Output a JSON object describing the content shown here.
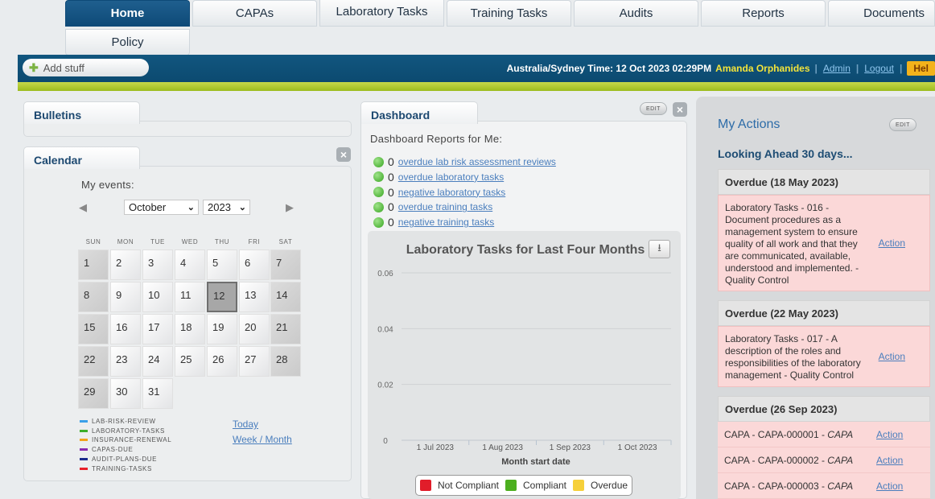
{
  "nav": {
    "tabs": [
      "Home",
      "CAPAs",
      "Laboratory Tasks",
      "Training Tasks",
      "Audits",
      "Reports",
      "Documents"
    ],
    "policy": "Policy"
  },
  "topbar": {
    "add_stuff": "Add stuff",
    "time_info": "Australia/Sydney Time: 12 Oct 2023 02:29PM",
    "user": "Amanda Orphanides",
    "admin": "Admin",
    "logout": "Logout",
    "help": "Hel"
  },
  "bulletins": {
    "title": "Bulletins"
  },
  "calendar": {
    "title": "Calendar",
    "my_events": "My events:",
    "month": "October",
    "year": "2023",
    "day_headers": [
      "SUN",
      "MON",
      "TUE",
      "WED",
      "THU",
      "FRI",
      "SAT"
    ],
    "weeks": [
      [
        "1",
        "2",
        "3",
        "4",
        "5",
        "6",
        "7"
      ],
      [
        "8",
        "9",
        "10",
        "11",
        "12",
        "13",
        "14"
      ],
      [
        "15",
        "16",
        "17",
        "18",
        "19",
        "20",
        "21"
      ],
      [
        "22",
        "23",
        "24",
        "25",
        "26",
        "27",
        "28"
      ],
      [
        "29",
        "30",
        "31"
      ]
    ],
    "today_day": "12",
    "legend": [
      {
        "label": "LAB-RISK-REVIEW",
        "color": "#3aa0e8"
      },
      {
        "label": "LABORATORY-TASKS",
        "color": "#3cae2c"
      },
      {
        "label": "INSURANCE-RENEWAL",
        "color": "#f0a21c"
      },
      {
        "label": "CAPAS-DUE",
        "color": "#8a2bb0"
      },
      {
        "label": "AUDIT-PLANS-DUE",
        "color": "#1c2b8c"
      },
      {
        "label": "TRAINING-TASKS",
        "color": "#e8202a"
      }
    ],
    "today_link": "Today",
    "week_month_link": "Week / Month"
  },
  "dashboard": {
    "title": "Dashboard",
    "edit": "EDIT",
    "reports_title": "Dashboard Reports for Me:",
    "reports": [
      {
        "count": "0",
        "label": "overdue lab risk assessment reviews"
      },
      {
        "count": "0",
        "label": "overdue laboratory tasks"
      },
      {
        "count": "0",
        "label": "negative laboratory tasks"
      },
      {
        "count": "0",
        "label": "overdue training tasks"
      },
      {
        "count": "0",
        "label": "negative training tasks"
      }
    ]
  },
  "chart_data": {
    "type": "bar",
    "title": "Laboratory Tasks for Last Four Months",
    "xlabel": "Month start date",
    "ylabel": "",
    "categories": [
      "1 Jul 2023",
      "1 Aug 2023",
      "1 Sep 2023",
      "1 Oct 2023"
    ],
    "yticks": [
      "0",
      "0.02",
      "0.04",
      "0.06"
    ],
    "ylim": [
      0,
      0.06
    ],
    "series": [
      {
        "name": "Not Compliant",
        "values": [
          0,
          0,
          0,
          0
        ],
        "color": "#e11d2a"
      },
      {
        "name": "Compliant",
        "values": [
          0,
          0,
          0,
          0
        ],
        "color": "#4caf1f"
      },
      {
        "name": "Overdue",
        "values": [
          0,
          0,
          0,
          0
        ],
        "color": "#f6d03a"
      }
    ],
    "grid": true,
    "legend_position": "bottom"
  },
  "my_actions": {
    "title": "My Actions",
    "edit": "EDIT",
    "looking_ahead": "Looking Ahead 30 days...",
    "groups": [
      {
        "header": "Overdue (18 May 2023)",
        "lines": [
          "Laboratory Tasks - 016 -",
          "Document procedures as a",
          "management system to ensure",
          "quality of all work and that they",
          "are communicated, available,",
          "understood and implemented. -",
          "Quality Control"
        ],
        "action": "Action"
      },
      {
        "header": "Overdue (22 May 2023)",
        "lines": [
          "Laboratory Tasks - 017 - A",
          "description of the roles and",
          "responsibilities of the laboratory",
          "management - Quality Control"
        ],
        "action": "Action"
      }
    ],
    "capa_header": "Overdue (26 Sep 2023)",
    "capa_rows": [
      {
        "prefix": "CAPA - CAPA-000001 - ",
        "type": "CAPA",
        "action": "Action"
      },
      {
        "prefix": "CAPA - CAPA-000002 - ",
        "type": "CAPA",
        "action": "Action"
      },
      {
        "prefix": "CAPA - CAPA-000003 - ",
        "type": "CAPA",
        "action": "Action"
      }
    ]
  }
}
